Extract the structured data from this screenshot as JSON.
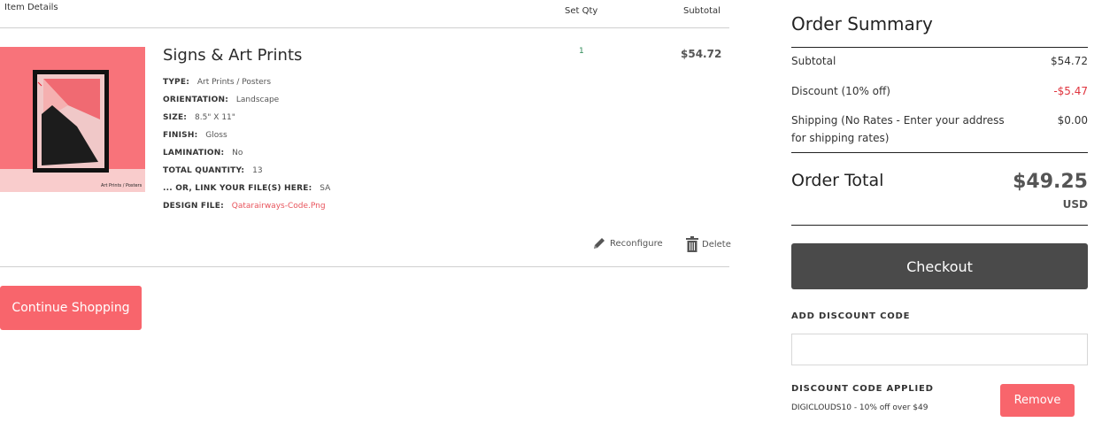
{
  "cart": {
    "headers": {
      "item_details": "Item Details",
      "set_qty": "Set Qty",
      "subtotal": "Subtotal"
    },
    "item": {
      "title": "Signs & Art Prints",
      "thumbnail_caption": "Art Prints / Posters",
      "attributes": [
        {
          "key": "TYPE:",
          "value": "Art Prints / Posters"
        },
        {
          "key": "ORIENTATION:",
          "value": "Landscape"
        },
        {
          "key": "SIZE:",
          "value": "8.5\" X 11\""
        },
        {
          "key": "FINISH:",
          "value": "Gloss"
        },
        {
          "key": "LAMINATION:",
          "value": "No"
        },
        {
          "key": "TOTAL QUANTITY:",
          "value": "13"
        },
        {
          "key": "... OR, LINK YOUR FILE(S) HERE:",
          "value": "SA"
        },
        {
          "key": "DESIGN FILE:",
          "value": "Qatarairways-Code.Png"
        }
      ],
      "qty": "1",
      "subtotal": "$54.72",
      "actions": {
        "reconfigure": "Reconfigure",
        "delete": "Delete"
      }
    },
    "continue_label": "Continue Shopping"
  },
  "summary": {
    "title": "Order Summary",
    "subtotal_label": "Subtotal",
    "subtotal_value": "$54.72",
    "discount_label": "Discount (10% off)",
    "discount_value": "-$5.47",
    "shipping_label": "Shipping (No Rates - Enter your address for shipping rates)",
    "shipping_value": "$0.00",
    "total_label": "Order Total",
    "total_value": "$49.25",
    "currency": "USD",
    "checkout_label": "Checkout",
    "add_code_heading": "ADD DISCOUNT CODE",
    "code_placeholder": "",
    "applied_heading": "DISCOUNT CODE APPLIED",
    "applied_code": "DIGICLOUDS10 - 10% off over $49",
    "remove_label": "Remove"
  },
  "colors": {
    "accent": "#f8656c",
    "checkout": "#4a4a4a",
    "discount": "#e0353f",
    "link": "#e8545c"
  }
}
